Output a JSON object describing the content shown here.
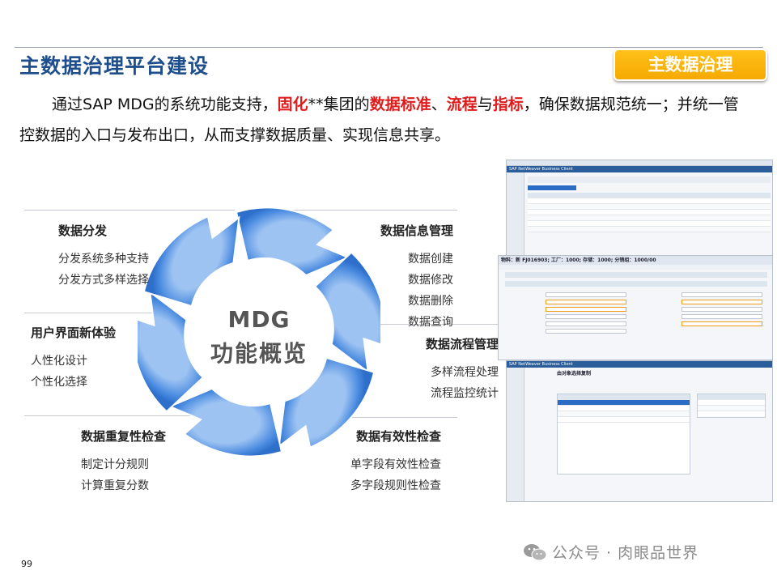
{
  "header": {
    "title": "主数据治理平台建设",
    "tag": "主数据治理"
  },
  "intro": {
    "p1": "通过SAP MDG的系统功能支持，",
    "hl1": "固化",
    "p2": "**集团的",
    "hl2": "数据标准",
    "p3": "、",
    "hl3": "流程",
    "p4": "与",
    "hl4": "指标",
    "p5": "，确保数据规范统一；并统一管控数据的入口与发布出口，从而支撑数据质量、实现信息共享。"
  },
  "center": {
    "line1": "MDG",
    "line2": "功能概览"
  },
  "features": {
    "distribute": {
      "title": "数据分发",
      "items": [
        "分发系统多种支持",
        "分发方式多样选择"
      ]
    },
    "ui": {
      "title": "用户界面新体验",
      "items": [
        "人性化设计",
        "个性化选择"
      ]
    },
    "duplicate": {
      "title": "数据重复性检查",
      "items": [
        "制定计分规则",
        "计算重复分数"
      ]
    },
    "info_mgmt": {
      "title": "数据信息管理",
      "items": [
        "数据创建",
        "数据修改",
        "数据删除",
        "数据查询"
      ]
    },
    "workflow": {
      "title": "数据流程管理",
      "items": [
        "多样流程处理",
        "流程监控统计"
      ]
    },
    "validity": {
      "title": "数据有效性检查",
      "items": [
        "单字段有效性检查",
        "多字段规则性检查"
      ]
    }
  },
  "screenshots": {
    "top_bar": "SAP NetWeaver Business Client",
    "mid_bar": "物料：新 FJ016903; 工厂：1000; 存储：1000; 分销组：1000/00",
    "bottom_bar": "SAP NetWeaver Business Client",
    "bottom_title": "由对象选择复制"
  },
  "footer": {
    "page_number": "99",
    "watermark": "公众号 · 肉眼品世界"
  },
  "colors": {
    "title": "#1f4e8c",
    "accent": "#f5a800",
    "highlight": "#e01b1b",
    "ring": "#3d7fd9"
  }
}
